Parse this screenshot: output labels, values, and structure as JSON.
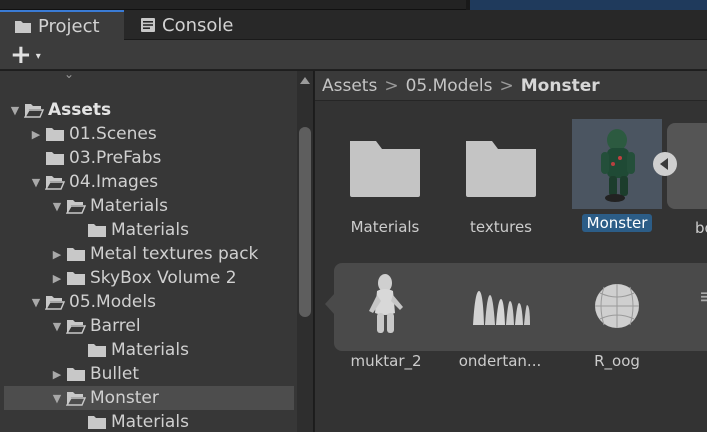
{
  "tabs": [
    {
      "label": "Project",
      "icon": "folder-icon",
      "active": true
    },
    {
      "label": "Console",
      "icon": "console-icon",
      "active": false
    }
  ],
  "toolbar": {
    "add_label": "+",
    "add_caret": "▾"
  },
  "tree": {
    "rows": [
      {
        "label": "Assets",
        "depth": 0,
        "expanded": true,
        "has_arrow": true,
        "bold": true,
        "open": true
      },
      {
        "label": "01.Scenes",
        "depth": 1,
        "expanded": false,
        "has_arrow": true
      },
      {
        "label": "03.PreFabs",
        "depth": 1,
        "expanded": false,
        "has_arrow": false
      },
      {
        "label": "04.Images",
        "depth": 1,
        "expanded": true,
        "has_arrow": true,
        "open": true
      },
      {
        "label": "Materials",
        "depth": 2,
        "expanded": true,
        "has_arrow": true,
        "open": true
      },
      {
        "label": "Materials",
        "depth": 3,
        "has_arrow": false
      },
      {
        "label": "Metal textures pack",
        "depth": 2,
        "expanded": false,
        "has_arrow": true
      },
      {
        "label": "SkyBox Volume 2",
        "depth": 2,
        "expanded": false,
        "has_arrow": true
      },
      {
        "label": "05.Models",
        "depth": 1,
        "expanded": true,
        "has_arrow": true,
        "open": true
      },
      {
        "label": "Barrel",
        "depth": 2,
        "expanded": true,
        "has_arrow": true,
        "open": true
      },
      {
        "label": "Materials",
        "depth": 3,
        "has_arrow": false
      },
      {
        "label": "Bullet",
        "depth": 2,
        "expanded": false,
        "has_arrow": true
      },
      {
        "label": "Monster",
        "depth": 2,
        "expanded": true,
        "has_arrow": true,
        "open": true,
        "selected": true
      },
      {
        "label": "Materials",
        "depth": 3,
        "has_arrow": false
      }
    ]
  },
  "breadcrumb": {
    "items": [
      "Assets",
      "05.Models"
    ],
    "current": "Monster",
    "separator": ">"
  },
  "assets": [
    {
      "label": "Materials",
      "kind": "folder"
    },
    {
      "label": "textures",
      "kind": "folder"
    },
    {
      "label": "Monster",
      "kind": "model",
      "selected": true
    }
  ],
  "next_asset_label": "bo",
  "sub_assets": [
    {
      "label": "muktar_2",
      "kind": "mesh-figure"
    },
    {
      "label": "ondertan...",
      "kind": "mesh-teeth"
    },
    {
      "label": "R_oog",
      "kind": "mesh-sphere"
    }
  ],
  "colors": {
    "accent": "#3a7bd5",
    "selection": "#2c5d87",
    "panel": "#373737"
  }
}
